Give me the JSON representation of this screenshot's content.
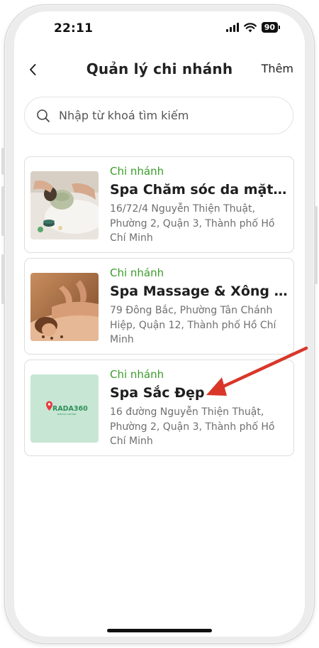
{
  "status_bar": {
    "time": "22:11",
    "battery": "90"
  },
  "header": {
    "title": "Quản lý chi nhánh",
    "add_label": "Thêm",
    "back_icon": "chevron-left-icon"
  },
  "search": {
    "placeholder": "Nhập từ khoá tìm kiếm",
    "value": "",
    "icon": "search-icon"
  },
  "branches": [
    {
      "tag": "Chi nhánh",
      "name": "Spa Chăm sóc da mặt Vip",
      "address": "16/72/4 Nguyễn Thiện Thuật, Phường 2, Quận 3, Thành phố Hồ Chí Minh",
      "image": "facial-treatment-photo"
    },
    {
      "tag": "Chi nhánh",
      "name": "Spa Massage & Xông hơi",
      "address": "79 Đông Bắc, Phường Tân Chánh Hiệp, Quận 12, Thành phố Hồ Chí Minh",
      "image": "massage-photo"
    },
    {
      "tag": "Chi nhánh",
      "name": "Spa Sắc Đẹp",
      "address": "16 đường Nguyễn Thiện Thuật, Phường 2, Quận 3, Thành phố Hồ Chí Minh",
      "image": "rada360-logo"
    }
  ],
  "logo": {
    "text": "RADA360",
    "subtext": "BẢN ĐỒ LÀM ĐẸP"
  },
  "colors": {
    "accent_green": "#3a9c2a",
    "arrow_red": "#d8372a"
  }
}
